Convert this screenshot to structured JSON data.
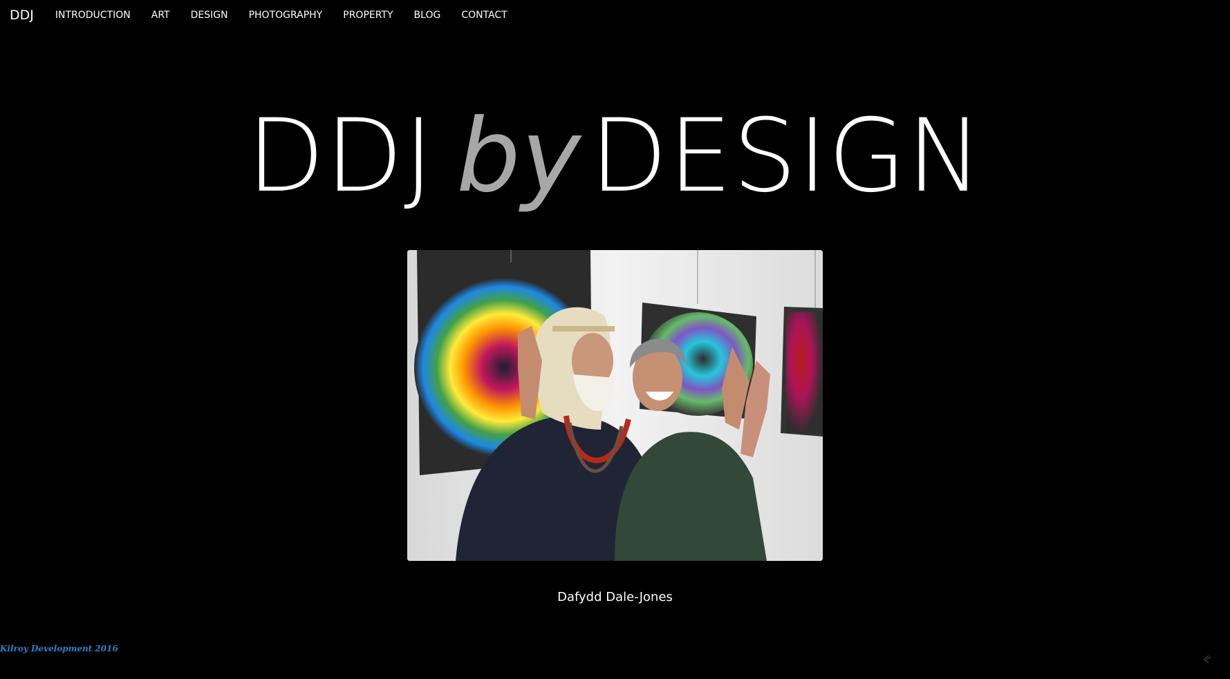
{
  "nav": {
    "brand": "DDJ",
    "items": [
      {
        "label": "INTRODUCTION"
      },
      {
        "label": "ART"
      },
      {
        "label": "DESIGN"
      },
      {
        "label": "PHOTOGRAPHY"
      },
      {
        "label": "PROPERTY"
      },
      {
        "label": "BLOG"
      },
      {
        "label": "CONTACT"
      }
    ]
  },
  "hero": {
    "part1": "DDJ",
    "part2": "by",
    "part3": "DESIGN"
  },
  "photo": {
    "caption": "Dafydd Dale-Jones"
  },
  "footer": {
    "credit": "Kilroy Development 2016",
    "corner_icon": "scroll-up-icon"
  },
  "colors": {
    "background": "#000000",
    "title_white": "#ffffff",
    "title_grey": "#a7a7a7",
    "credit_blue": "#2f82c8"
  }
}
